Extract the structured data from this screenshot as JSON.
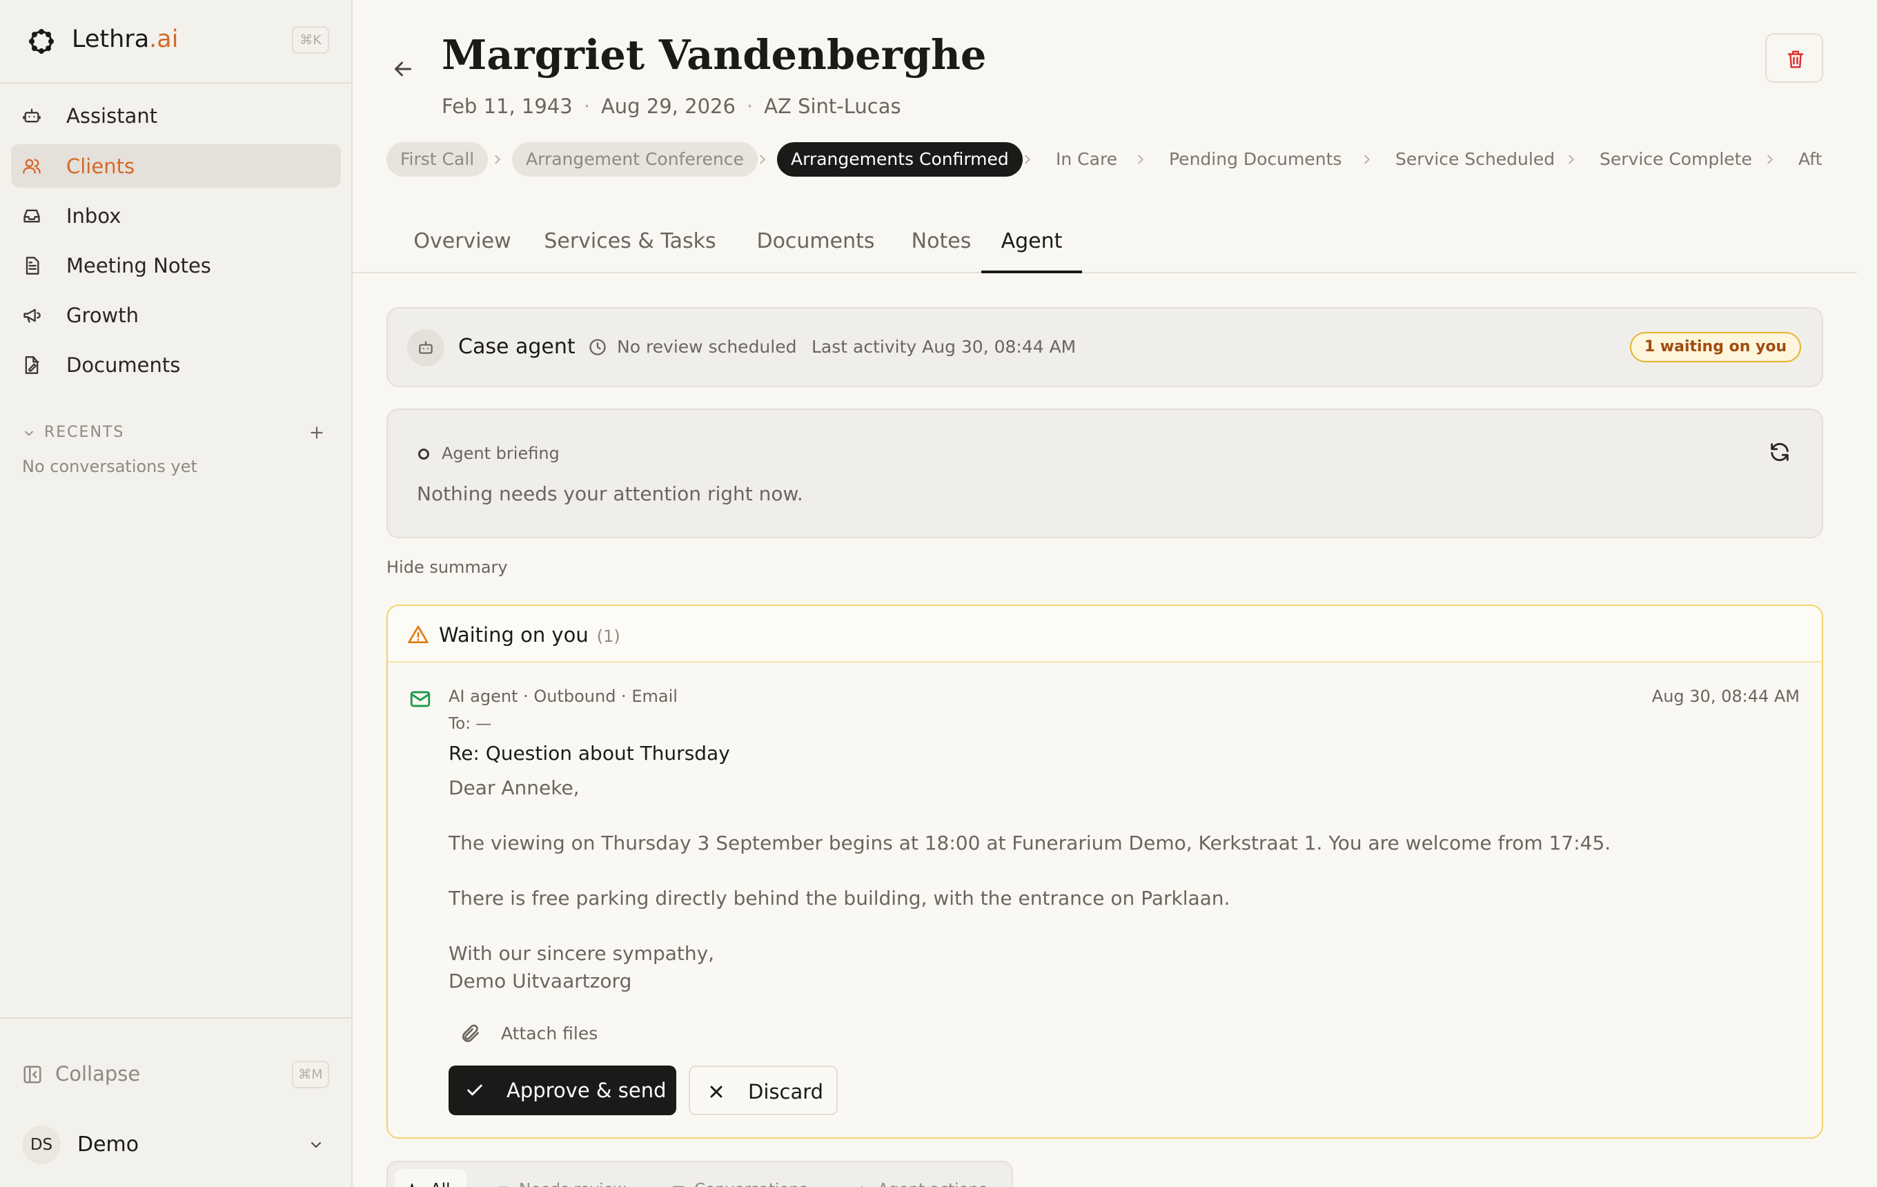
{
  "sidebar": {
    "brand": {
      "name": "Lethra",
      "accent": ".ai",
      "shortcut": "⌘K"
    },
    "nav": [
      {
        "label": "Assistant",
        "icon": "robot-icon"
      },
      {
        "label": "Clients",
        "icon": "users-icon",
        "active": true
      },
      {
        "label": "Inbox",
        "icon": "inbox-icon"
      },
      {
        "label": "Meeting Notes",
        "icon": "document-icon"
      },
      {
        "label": "Growth",
        "icon": "megaphone-icon"
      },
      {
        "label": "Documents",
        "icon": "file-edit-icon"
      }
    ],
    "recents": {
      "label": "RECENTS",
      "empty": "No conversations yet"
    },
    "collapse": {
      "label": "Collapse",
      "shortcut": "⌘M"
    },
    "user": {
      "initials": "DS",
      "name": "Demo"
    }
  },
  "header": {
    "title": "Margriet Vandenberghe",
    "birth": "Feb 11, 1943",
    "death": "Aug 29, 2026",
    "location": "AZ Sint-Lucas"
  },
  "stages": [
    {
      "label": "First Call",
      "state": "done"
    },
    {
      "label": "Arrangement Conference",
      "state": "done"
    },
    {
      "label": "Arrangements Confirmed",
      "state": "current"
    },
    {
      "label": "In Care",
      "state": "upcoming"
    },
    {
      "label": "Pending Documents",
      "state": "upcoming"
    },
    {
      "label": "Service Scheduled",
      "state": "upcoming"
    },
    {
      "label": "Service Complete",
      "state": "upcoming"
    },
    {
      "label": "Aft",
      "state": "upcoming"
    }
  ],
  "tabs": [
    {
      "label": "Overview"
    },
    {
      "label": "Services & Tasks"
    },
    {
      "label": "Documents"
    },
    {
      "label": "Notes"
    },
    {
      "label": "Agent",
      "active": true
    }
  ],
  "agent": {
    "name": "Case agent",
    "review": "No review scheduled",
    "last_activity": "Last activity Aug 30, 08:44 AM",
    "waiting_badge": "1 waiting on you"
  },
  "briefing": {
    "label": "Agent briefing",
    "text": "Nothing needs your attention right now.",
    "hide_summary": "Hide summary"
  },
  "waiting": {
    "title": "Waiting on you",
    "count": "(1)",
    "message": {
      "meta": "AI agent · Outbound · Email",
      "time": "Aug 30, 08:44 AM",
      "to": "To: —",
      "subject": "Re: Question about Thursday",
      "body": [
        "Dear Anneke,",
        "The viewing on Thursday 3 September begins at 18:00 at Funerarium Demo, Kerkstraat 1. You are welcome from 17:45.",
        "There is free parking directly behind the building, with the entrance on Parklaan.",
        "With our sincere sympathy,",
        "Demo Uitvaartzorg"
      ],
      "attach": "Attach files",
      "approve": "Approve & send",
      "discard": "Discard"
    }
  },
  "filters": [
    {
      "label": "All",
      "active": true
    },
    {
      "label": "Needs review"
    },
    {
      "label": "Conversations"
    },
    {
      "label": "Agent actions"
    }
  ],
  "colors": {
    "accent": "#d4692a",
    "warning": "#e07a14",
    "danger": "#d93030",
    "mail": "#1a9a4a"
  }
}
